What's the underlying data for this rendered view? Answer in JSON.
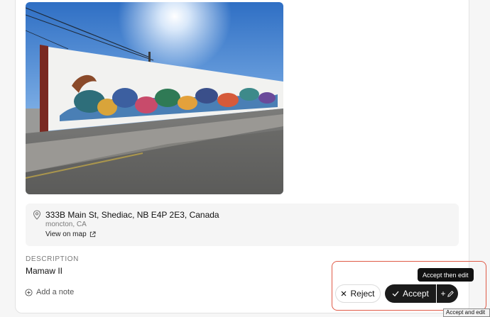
{
  "photo": {
    "alt": "Mural painted on a long white building wall along a street"
  },
  "location": {
    "address": "333B Main St, Shediac, NB E4P 2E3, Canada",
    "area": "moncton, CA",
    "map_link": "View on map"
  },
  "description": {
    "label": "DESCRIPTION",
    "value": "Mamaw II"
  },
  "actions": {
    "add_note": "Add a note",
    "reject": "Reject",
    "accept": "Accept",
    "edit_glyph": "+",
    "tooltip": "Accept then edit",
    "native_tooltip": "Accept and edit"
  },
  "colors": {
    "highlight_border": "#e05a47",
    "accept_bg": "#1b1b1b"
  }
}
